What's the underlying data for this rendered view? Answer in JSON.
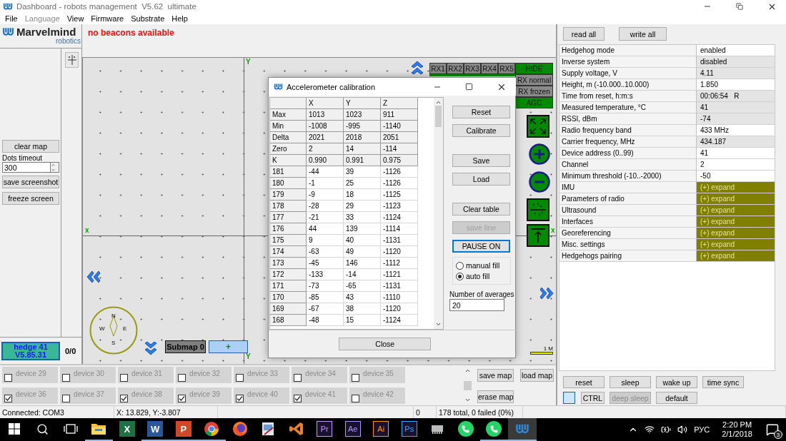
{
  "window": {
    "title": "Dashboard - robots management  V5.62  ultimate"
  },
  "menu": [
    {
      "label": "File",
      "disabled": false
    },
    {
      "label": "Language",
      "disabled": true
    },
    {
      "label": "View",
      "disabled": false
    },
    {
      "label": "Firmware",
      "disabled": false
    },
    {
      "label": "Substrate",
      "disabled": false
    },
    {
      "label": "Help",
      "disabled": false
    }
  ],
  "logo": {
    "name": "Marvelmind",
    "tagline": "robotics"
  },
  "left_panel": {
    "clear_button": "clear map",
    "timeout": {
      "label": "Dots timeout",
      "value": "300"
    },
    "buttons": [
      "save screenshot",
      "freeze screen"
    ],
    "hedge": {
      "name": "hedge 41",
      "version": "V5.85.31"
    },
    "count": "0/0"
  },
  "map": {
    "message": "no beacons available",
    "y_labels": [
      "Y",
      "Y"
    ],
    "x_labels": [
      "x",
      "x"
    ],
    "rx_buttons": [
      "RX1",
      "RX2",
      "RX3",
      "RX4",
      "RX5"
    ],
    "toggles": [
      {
        "label": "HIDE",
        "on": true
      },
      {
        "label": "RX normal",
        "on": false
      },
      {
        "label": "RX frozen",
        "on": false
      },
      {
        "label": "AGC",
        "on": true
      }
    ],
    "compass": [
      "N",
      "W",
      "E",
      "S"
    ],
    "submap": "Submap 0",
    "add": "+",
    "scale": "1 M"
  },
  "dialog": {
    "title": "Accelerometer calibration",
    "columns": [
      "X",
      "Y",
      "Z"
    ],
    "rows": [
      {
        "kind": "summary",
        "label": "Max",
        "values": [
          "1013",
          "1023",
          "911"
        ]
      },
      {
        "kind": "summary",
        "label": "Min",
        "values": [
          "-1008",
          "-995",
          "-1140"
        ]
      },
      {
        "kind": "summary",
        "label": "Delta",
        "values": [
          "2021",
          "2018",
          "2051"
        ]
      },
      {
        "kind": "summary",
        "label": "Zero",
        "values": [
          "2",
          "14",
          "-114"
        ]
      },
      {
        "kind": "summary",
        "label": "K",
        "values": [
          "0.990",
          "0.991",
          "0.975"
        ]
      },
      {
        "kind": "sample",
        "label": "181",
        "values": [
          "-44",
          "39",
          "-1126"
        ]
      },
      {
        "kind": "sample",
        "label": "180",
        "values": [
          "-1",
          "25",
          "-1126"
        ]
      },
      {
        "kind": "sample",
        "label": "179",
        "values": [
          "-9",
          "18",
          "-1125"
        ]
      },
      {
        "kind": "sample",
        "label": "178",
        "values": [
          "-28",
          "29",
          "-1123"
        ]
      },
      {
        "kind": "sample",
        "label": "177",
        "values": [
          "-21",
          "33",
          "-1124"
        ]
      },
      {
        "kind": "sample",
        "label": "176",
        "values": [
          "44",
          "139",
          "-1114"
        ]
      },
      {
        "kind": "sample",
        "label": "175",
        "values": [
          "9",
          "40",
          "-1131"
        ]
      },
      {
        "kind": "sample",
        "label": "174",
        "values": [
          "-63",
          "49",
          "-1120"
        ]
      },
      {
        "kind": "sample",
        "label": "173",
        "values": [
          "-45",
          "146",
          "-1112"
        ]
      },
      {
        "kind": "sample",
        "label": "172",
        "values": [
          "-133",
          "-14",
          "-1121"
        ]
      },
      {
        "kind": "sample",
        "label": "171",
        "values": [
          "-73",
          "-65",
          "-1131"
        ]
      },
      {
        "kind": "sample",
        "label": "170",
        "values": [
          "-85",
          "43",
          "-1110"
        ]
      },
      {
        "kind": "sample",
        "label": "169",
        "values": [
          "-67",
          "38",
          "-1120"
        ]
      },
      {
        "kind": "sample",
        "label": "168",
        "values": [
          "-48",
          "15",
          "-1124"
        ]
      }
    ],
    "button_groups": [
      [
        {
          "label": "Reset",
          "disabled": false,
          "focused": false
        },
        {
          "label": "Calibrate",
          "disabled": false,
          "focused": false
        }
      ],
      [
        {
          "label": "Save",
          "disabled": false,
          "focused": false
        },
        {
          "label": "Load",
          "disabled": false,
          "focused": false
        }
      ],
      [
        {
          "label": "Clear table",
          "disabled": false,
          "focused": false
        },
        {
          "label": "save line",
          "disabled": true,
          "focused": false
        },
        {
          "label": "PAUSE ON",
          "disabled": false,
          "focused": true
        }
      ]
    ],
    "fill_modes": [
      {
        "label": "manual fill",
        "selected": false
      },
      {
        "label": "auto fill",
        "selected": true
      }
    ],
    "averages": {
      "label": "Number of averages",
      "value": "20"
    },
    "close": "Close"
  },
  "devices": [
    {
      "label": "device 29",
      "checked": false
    },
    {
      "label": "device 30",
      "checked": false
    },
    {
      "label": "device 31",
      "checked": false
    },
    {
      "label": "device 32",
      "checked": false
    },
    {
      "label": "device 33",
      "checked": false
    },
    {
      "label": "device 34",
      "checked": false
    },
    {
      "label": "device 35",
      "checked": false
    },
    {
      "label": "device 36",
      "checked": true
    },
    {
      "label": "device 37",
      "checked": false
    },
    {
      "label": "device 38",
      "checked": true
    },
    {
      "label": "device 39",
      "checked": true
    },
    {
      "label": "device 40",
      "checked": true
    },
    {
      "label": "device 41",
      "checked": true
    },
    {
      "label": "device 42",
      "checked": false
    }
  ],
  "map_buttons": {
    "save": "save map",
    "load": "load map",
    "erase": "erase map"
  },
  "right_panel": {
    "buttons": [
      "read all",
      "write all"
    ],
    "properties": [
      {
        "kind": "value",
        "name": "Hedgehog mode",
        "value": "enabled",
        "editable": true
      },
      {
        "kind": "value",
        "name": "Inverse system",
        "value": "disabled",
        "editable": false
      },
      {
        "kind": "value",
        "name": "Supply voltage, V",
        "value": "4.11",
        "editable": false
      },
      {
        "kind": "value",
        "name": "Height, m (-10.000..10.000)",
        "value": "1.850",
        "editable": true
      },
      {
        "kind": "value",
        "name": "Time from reset, h:m:s",
        "value": "00:06:54   R",
        "editable": false
      },
      {
        "kind": "value",
        "name": "Measured temperature, °C",
        "value": "41",
        "editable": false
      },
      {
        "kind": "value",
        "name": "RSSI, dBm",
        "value": "-74",
        "editable": false
      },
      {
        "kind": "value",
        "name": "Radio frequency band",
        "value": "433 MHz",
        "editable": true
      },
      {
        "kind": "value",
        "name": "Carrier frequency, MHz",
        "value": "434.187",
        "editable": false
      },
      {
        "kind": "value",
        "name": "Device address (0..99)",
        "value": "41",
        "editable": true
      },
      {
        "kind": "value",
        "name": "Channel",
        "value": "2",
        "editable": true
      },
      {
        "kind": "value",
        "name": "Minimum threshold (-10..-2000)",
        "value": "-50",
        "editable": true
      },
      {
        "kind": "group",
        "name": "IMU",
        "value": "(+) expand"
      },
      {
        "kind": "group",
        "name": "Parameters of radio",
        "value": "(+) expand"
      },
      {
        "kind": "group",
        "name": "Ultrasound",
        "value": "(+) expand"
      },
      {
        "kind": "group",
        "name": "Interfaces",
        "value": "(+) expand"
      },
      {
        "kind": "group",
        "name": "Georeferencing",
        "value": "(+) expand"
      },
      {
        "kind": "group",
        "name": "Misc. settings",
        "value": "(+) expand"
      },
      {
        "kind": "group",
        "name": "Hedgehogs pairing",
        "value": "(+) expand"
      }
    ],
    "actions": [
      [
        {
          "kind": "button",
          "label": "reset",
          "disabled": false
        },
        {
          "kind": "button",
          "label": "sleep",
          "disabled": false
        },
        {
          "kind": "button",
          "label": "wake up",
          "disabled": false
        },
        {
          "kind": "button",
          "label": "time sync",
          "disabled": false
        }
      ],
      [
        {
          "kind": "swatch"
        },
        {
          "kind": "small",
          "label": "CTRL",
          "disabled": false
        },
        {
          "kind": "button",
          "label": "deep sleep",
          "disabled": true
        },
        {
          "kind": "button",
          "label": "default",
          "disabled": false
        }
      ]
    ]
  },
  "status_bar": [
    "Connected: COM3",
    "X: 13.829, Y:-3.807",
    "0",
    "178 total, 0 failed (0%)"
  ],
  "taskbar": {
    "apps": [
      {
        "kind": "folder",
        "running": true,
        "active": false
      },
      {
        "kind": "tile",
        "glyph": "X",
        "color": "#1e7145",
        "running": false,
        "active": false
      },
      {
        "kind": "tile",
        "glyph": "W",
        "color": "#2b579a",
        "running": true,
        "active": false
      },
      {
        "kind": "tile",
        "glyph": "P",
        "color": "#d24726",
        "running": true,
        "active": false
      },
      {
        "kind": "chrome",
        "running": true,
        "active": false
      },
      {
        "kind": "firefox",
        "running": false,
        "active": false
      },
      {
        "kind": "paint",
        "running": false,
        "active": false
      },
      {
        "kind": "vs",
        "running": false,
        "active": false
      },
      {
        "kind": "outline",
        "glyph": "Pr",
        "color": "#c896ff",
        "running": false,
        "active": false
      },
      {
        "kind": "outline",
        "glyph": "Ae",
        "color": "#a999ff",
        "running": false,
        "active": false
      },
      {
        "kind": "outline",
        "glyph": "Ai",
        "color": "#ff9a00",
        "running": false,
        "active": false
      },
      {
        "kind": "outline",
        "glyph": "Ps",
        "color": "#31a8ff",
        "running": false,
        "active": false
      },
      {
        "kind": "chip",
        "running": false,
        "active": false
      },
      {
        "kind": "whatsapp",
        "running": false,
        "active": false
      },
      {
        "kind": "whatsapp",
        "running": true,
        "active": false
      },
      {
        "kind": "marvelmind",
        "running": true,
        "active": true
      }
    ],
    "language": "РУС",
    "time": "2:20 PM",
    "date": "2/1/2018",
    "notifications": "3"
  }
}
